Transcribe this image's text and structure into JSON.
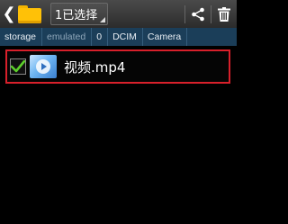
{
  "topbar": {
    "back_icon": "chevron-left-icon",
    "folder_icon": "folder-icon",
    "selection_label": "1已选择",
    "share_icon": "share-icon",
    "delete_icon": "trash-icon"
  },
  "breadcrumb": {
    "items": [
      "storage",
      "emulated",
      "0",
      "DCIM",
      "Camera"
    ]
  },
  "files": [
    {
      "name": "视频.mp4",
      "checked": true,
      "thumbnail": "video-thumbnail"
    }
  ],
  "colors": {
    "topbar_bg": "#3a3a3a",
    "breadcrumb_bg": "#1b3e59",
    "highlight_border": "#d8202b",
    "check_green": "#5ccf2a",
    "folder_yellow": "#ffc107"
  }
}
